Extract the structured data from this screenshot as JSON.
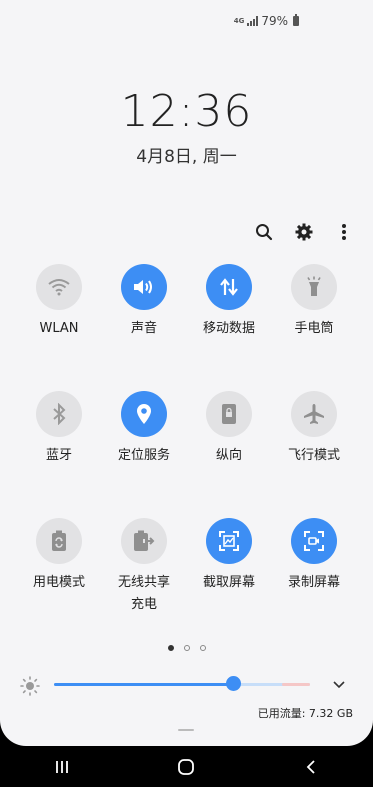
{
  "status_bar": {
    "network": "4G",
    "battery": "79%",
    "battery_icon": "battery-icon",
    "signal_icon": "signal-icon"
  },
  "lock": {
    "time": "12:36",
    "date": "4月8日, 周一"
  },
  "toolbar": {
    "icons": [
      "search-icon",
      "gear-icon",
      "more-vert-icon"
    ]
  },
  "tiles": [
    {
      "label": "WLAN",
      "state": "off",
      "icon": "wifi-icon"
    },
    {
      "label": "声音",
      "state": "on",
      "icon": "volume-icon"
    },
    {
      "label": "移动数据",
      "state": "on",
      "icon": "mobile-data-icon"
    },
    {
      "label": "手电筒",
      "state": "off",
      "icon": "flashlight-icon"
    },
    {
      "label": "蓝牙",
      "state": "off",
      "icon": "bluetooth-icon"
    },
    {
      "label": "定位服务",
      "state": "on",
      "icon": "location-icon"
    },
    {
      "label": "纵向",
      "state": "off",
      "icon": "portrait-lock-icon"
    },
    {
      "label": "飞行模式",
      "state": "off",
      "icon": "airplane-icon"
    },
    {
      "label": "用电模式",
      "state": "off",
      "icon": "power-mode-icon"
    },
    {
      "label": "无线共享\n充电",
      "label_line1": "无线共享",
      "label_line2": "充电",
      "state": "off",
      "icon": "wireless-share-icon"
    },
    {
      "label": "截取屏幕",
      "state": "on",
      "icon": "screenshot-icon"
    },
    {
      "label": "录制屏幕",
      "state": "on",
      "icon": "screen-record-icon"
    }
  ],
  "pager": {
    "pages": 3,
    "current": 1
  },
  "brightness": {
    "level": 0.7,
    "icon": "brightness-icon",
    "expand_icon": "chevron-down-icon"
  },
  "data_usage": "已用流量: 7.32 GB",
  "navbar": {
    "icons": [
      "recents-icon",
      "home-icon",
      "back-icon"
    ]
  },
  "colors": {
    "accent": "#3d8ef4",
    "tile_off": "#e2e2e4",
    "background": "#f5f5f7"
  }
}
